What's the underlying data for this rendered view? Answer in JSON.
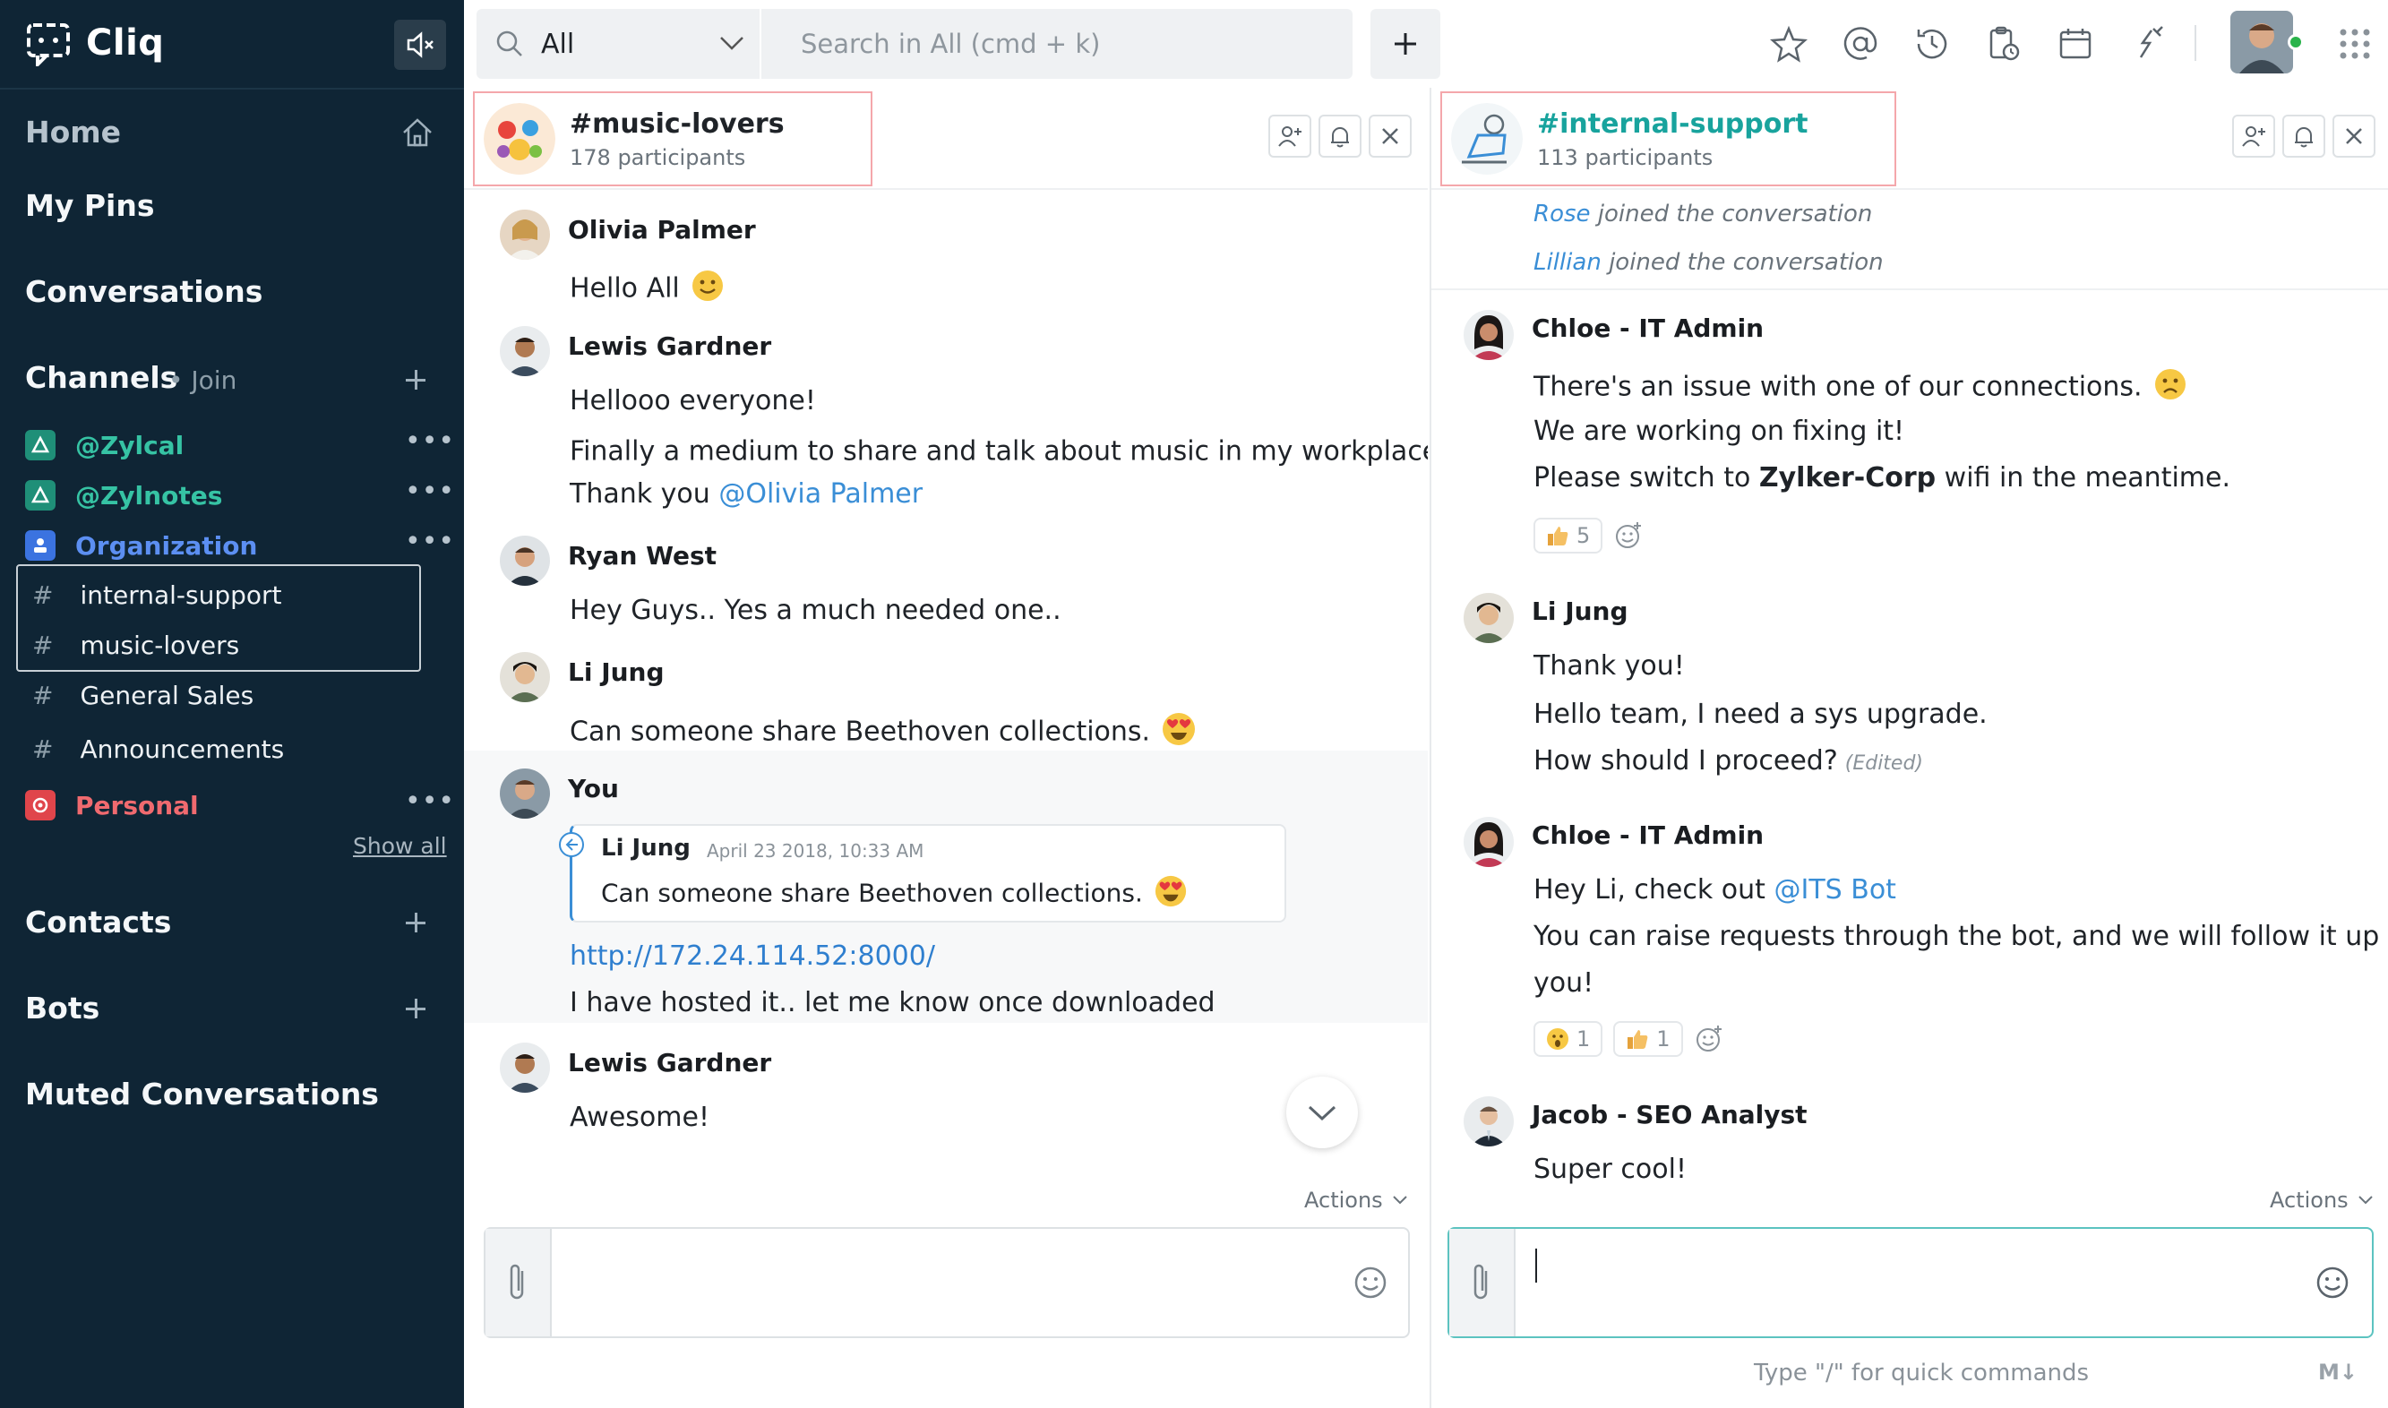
{
  "app": {
    "name": "Cliq"
  },
  "sidebar": {
    "home": "Home",
    "pins": "My Pins",
    "conversations": "Conversations",
    "channels": {
      "label": "Channels",
      "join": "• Join"
    },
    "orgs": [
      {
        "label": "@Zylcal",
        "color": "#36c3a4"
      },
      {
        "label": "@Zylnotes",
        "color": "#36c3a4"
      },
      {
        "label": "Organization",
        "color": "#5c8ff2"
      }
    ],
    "channel_list": [
      "internal-support",
      "music-lovers",
      "General Sales",
      "Announcements"
    ],
    "personal": {
      "label": "Personal",
      "color": "#f06a6f"
    },
    "show_all": "Show all",
    "contacts": "Contacts",
    "bots": "Bots",
    "muted": "Muted Conversations"
  },
  "topbar": {
    "scope": "All",
    "search_placeholder": "Search in All (cmd + k)"
  },
  "left_chat": {
    "title": "#music-lovers",
    "participants": "178 participants",
    "messages": [
      {
        "sender": "Olivia Palmer",
        "lines": [
          "Hello All"
        ]
      },
      {
        "sender": "Lewis Gardner",
        "lines": [
          "Hellooo everyone!",
          "Finally a medium to share and talk about music in my workplace!",
          "Thank you",
          "@Olivia Palmer"
        ]
      },
      {
        "sender": "Ryan West",
        "lines": [
          "Hey Guys..  Yes a much needed one.."
        ]
      },
      {
        "sender": "Li Jung",
        "lines": [
          "Can someone share Beethoven collections."
        ]
      },
      {
        "sender": "You",
        "quote": {
          "sender": "Li Jung",
          "time": "April 23 2018, 10:33 AM",
          "text": "Can someone share Beethoven collections."
        },
        "lines": [
          "http://172.24.114.52:8000/",
          "I have hosted it.. let me know once downloaded"
        ]
      },
      {
        "sender": "Lewis Gardner",
        "lines": [
          "Awesome!"
        ]
      }
    ],
    "actions": "Actions"
  },
  "right_chat": {
    "title": "#internal-support",
    "participants": "113 participants",
    "system": [
      {
        "who": "Rose",
        "text": "joined the conversation"
      },
      {
        "who": "Lillian",
        "text": "joined the conversation"
      }
    ],
    "messages": [
      {
        "sender": "Chloe - IT Admin",
        "lines": [
          "There's an issue with one of our connections.",
          "We are working on fixing it!",
          "Please switch to",
          "Zylker-Corp",
          "wifi in the meantime."
        ],
        "reactions": [
          "5"
        ]
      },
      {
        "sender": "Li Jung",
        "lines": [
          "Thank you!",
          "Hello team, I need a sys upgrade.",
          "How should I proceed?"
        ],
        "edited": "(Edited)"
      },
      {
        "sender": "Chloe - IT Admin",
        "lines": [
          "Hey Li, check out",
          "@ITS Bot",
          "You can raise requests through the bot, and we will follow it up with",
          "you!"
        ],
        "reactions": [
          "1",
          "1"
        ]
      },
      {
        "sender": "Jacob - SEO Analyst",
        "lines": [
          "Super cool!"
        ]
      }
    ],
    "actions": "Actions",
    "hint": "Type \"/\" for quick commands",
    "md": "M↓"
  }
}
